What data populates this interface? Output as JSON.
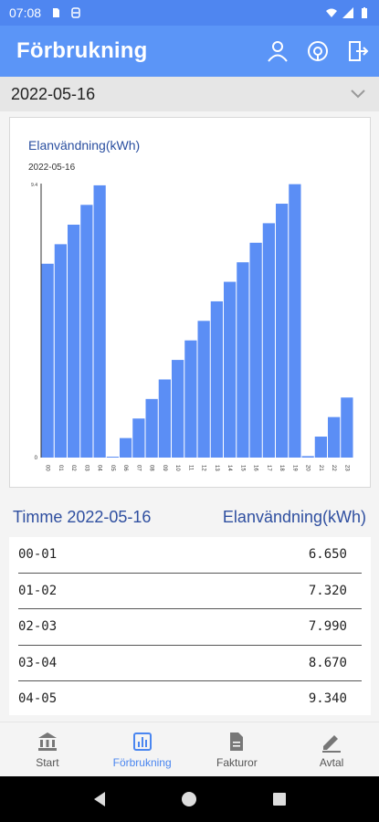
{
  "status_bar": {
    "time": "07:08"
  },
  "app_bar": {
    "title": "Förbrukning",
    "icons": [
      "person-icon",
      "support-icon",
      "logout-icon"
    ]
  },
  "date_selector": {
    "value": "2022-05-16"
  },
  "colors": {
    "primary": "#5b95f7",
    "bar": "#5b8ef5",
    "header_text": "#2f4fa0"
  },
  "chart_data": {
    "type": "bar",
    "title": "Elanvändning(kWh)",
    "subtitle": "2022-05-16",
    "categories": [
      "00",
      "01",
      "02",
      "03",
      "04",
      "05",
      "06",
      "07",
      "08",
      "09",
      "10",
      "11",
      "12",
      "13",
      "14",
      "15",
      "16",
      "17",
      "18",
      "19",
      "20",
      "21",
      "22",
      "23"
    ],
    "values": [
      6.65,
      7.32,
      7.99,
      8.67,
      9.34,
      0.0,
      0.67,
      1.34,
      2.01,
      2.68,
      3.35,
      4.02,
      4.69,
      5.36,
      6.03,
      6.7,
      7.37,
      8.04,
      8.71,
      9.38,
      0.05,
      0.72,
      1.39,
      2.06
    ],
    "ytick_labels": [
      "9.4",
      "0"
    ],
    "ylim": [
      0,
      9.4
    ],
    "grid": false,
    "legend": "none"
  },
  "table": {
    "header": {
      "col1": "Timme 2022-05-16",
      "col2": "Elanvändning(kWh)"
    },
    "rows": [
      {
        "hour": "00-01",
        "value": "6.650"
      },
      {
        "hour": "01-02",
        "value": "7.320"
      },
      {
        "hour": "02-03",
        "value": "7.990"
      },
      {
        "hour": "03-04",
        "value": "8.670"
      },
      {
        "hour": "04-05",
        "value": "9.340"
      }
    ]
  },
  "bottom_nav": {
    "items": [
      {
        "label": "Start",
        "icon": "bank-icon",
        "active": false
      },
      {
        "label": "Förbrukning",
        "icon": "bar-chart-icon",
        "active": true
      },
      {
        "label": "Fakturor",
        "icon": "document-icon",
        "active": false
      },
      {
        "label": "Avtal",
        "icon": "pen-icon",
        "active": false
      }
    ]
  }
}
